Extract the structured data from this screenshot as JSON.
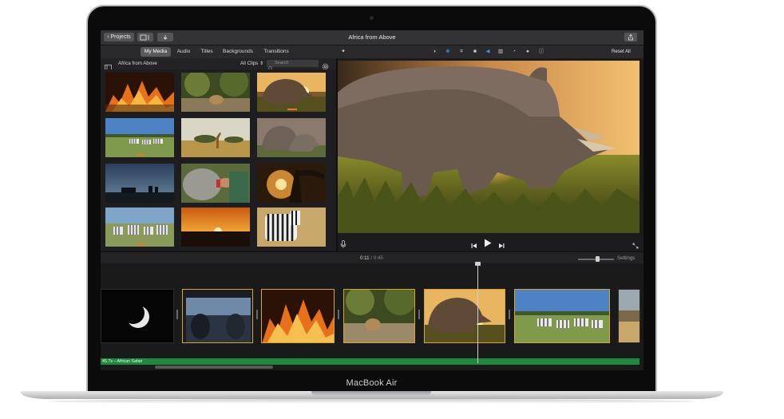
{
  "device": {
    "brand_label": "MacBook Air"
  },
  "app": {
    "window_title": "Africa from Above",
    "projects_button": "Projects",
    "tabs": [
      {
        "label": "My Media",
        "active": true
      },
      {
        "label": "Audio",
        "active": false
      },
      {
        "label": "Titles",
        "active": false
      },
      {
        "label": "Backgrounds",
        "active": false
      },
      {
        "label": "Transitions",
        "active": false
      }
    ],
    "library": {
      "event_name": "Africa from Above",
      "filter_label": "All Clips",
      "search_placeholder": "Search"
    },
    "adjustments": {
      "icons": [
        "magic-wand-icon",
        "color-balance-icon",
        "color-correction-icon",
        "crop-icon",
        "stabilization-icon",
        "volume-icon",
        "equalizer-icon",
        "speed-icon",
        "filter-icon",
        "info-icon"
      ],
      "active_icon": "color-correction-icon",
      "reset_label": "Reset All"
    },
    "playback": {
      "current_time": "0:11",
      "separator": "/",
      "total_time": "0:45",
      "settings_label": "Settings",
      "zoom_level": 0.55
    },
    "timeline": {
      "audio_clip_label": "45.7s – African Safari",
      "clips": [
        "moon",
        "jeep",
        "fire",
        "cub",
        "rhino",
        "zebras",
        "partial"
      ]
    },
    "media_thumbnails": [
      "fire",
      "forest-cub",
      "rhino-sunset",
      "zebras-plain",
      "giraffes",
      "rhinos",
      "silhouette-dusk",
      "hand-feeding",
      "tree-sunset",
      "zebras-herd",
      "sunset-horizon",
      "zebra-closeup"
    ]
  },
  "colors": {
    "accent": "#3f8bf0",
    "clip_border": "#d9a52c",
    "audio_track": "#1f8a3e",
    "range_marker": "#e5782a"
  }
}
